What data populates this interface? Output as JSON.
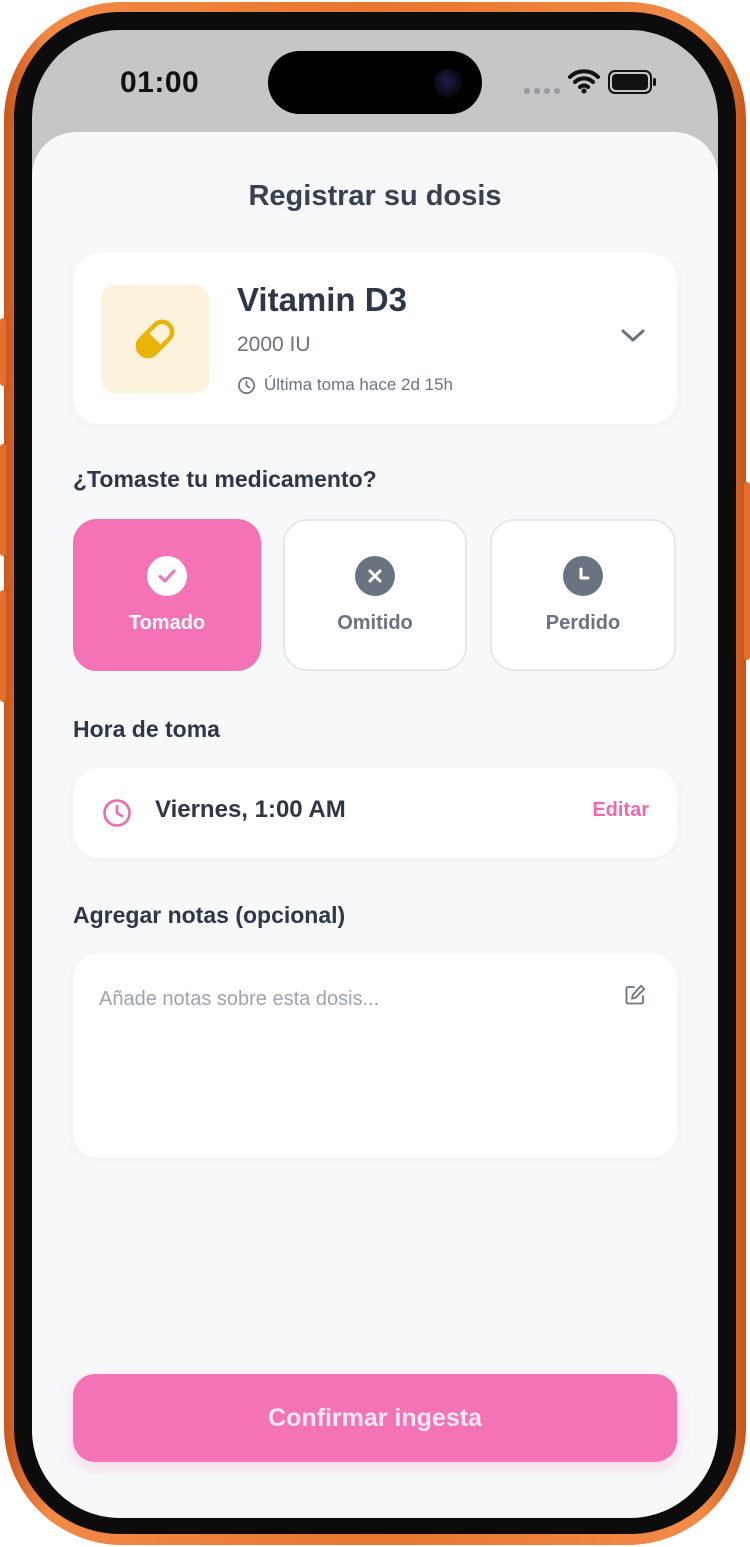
{
  "status_bar": {
    "time": "01:00"
  },
  "sheet": {
    "title": "Registrar su dosis"
  },
  "medication": {
    "name": "Vitamin D3",
    "dose": "2000 IU",
    "last_taken": "Última toma hace 2d 15h",
    "icon": "pill-icon"
  },
  "status_question": "¿Tomaste tu medicamento?",
  "status_options": [
    {
      "label": "Tomado",
      "icon": "check-circle-icon",
      "selected": true
    },
    {
      "label": "Omitido",
      "icon": "x-circle-icon",
      "selected": false
    },
    {
      "label": "Perdido",
      "icon": "clock-circle-icon",
      "selected": false
    }
  ],
  "time_section": {
    "label": "Hora de toma",
    "value": "Viernes, 1:00 AM",
    "edit_label": "Editar"
  },
  "notes_section": {
    "label": "Agregar notas (opcional)",
    "placeholder": "Añade notas sobre esta dosis...",
    "value": ""
  },
  "confirm_button": {
    "label": "Confirmar ingesta"
  },
  "colors": {
    "accent": "#f472b6",
    "accent_text": "#ec6aad",
    "text_dark": "#2e3747",
    "text_muted": "#6b7280",
    "pill": "#eab308",
    "pill_bg": "#fdf3dc",
    "frame": "#e9762f"
  }
}
